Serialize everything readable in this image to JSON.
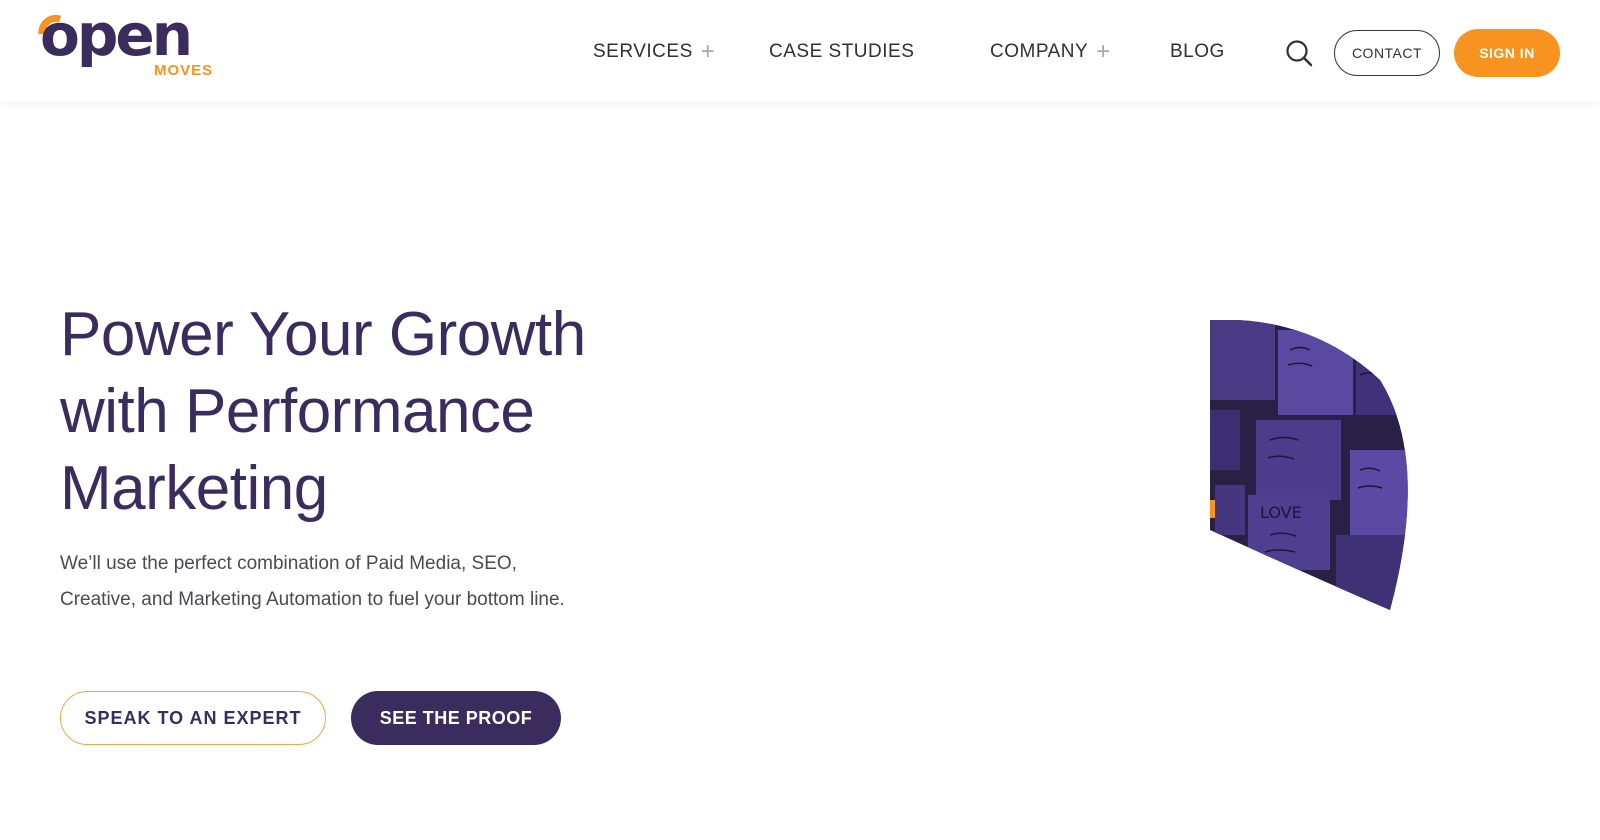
{
  "brand": {
    "logo_main": "open",
    "logo_sub": "MOVES",
    "accent_color": "#f7931e",
    "primary_color": "#3b2c5e"
  },
  "nav": {
    "items": [
      {
        "label": "SERVICES",
        "has_submenu": true,
        "submenu_icon": "plus-icon"
      },
      {
        "label": "CASE STUDIES",
        "has_submenu": false
      },
      {
        "label": "COMPANY",
        "has_submenu": true,
        "submenu_icon": "plus-icon"
      },
      {
        "label": "BLOG",
        "has_submenu": false
      }
    ],
    "plus_glyph": "+",
    "search_icon": "search-icon",
    "contact_label": "CONTACT",
    "signin_label": "SIGN IN"
  },
  "hero": {
    "title_lines": [
      "Power Your Growth",
      "with Performance",
      "Marketing"
    ],
    "subtitle_lines": [
      "We’ll use the perfect combination of Paid Media, SEO,",
      "Creative, and Marketing Automation to fuel your bottom line."
    ],
    "primary_cta": "SPEAK TO AN EXPERT",
    "secondary_cta": "SEE THE PROOF",
    "image_note_texts": [
      "LOVE"
    ]
  }
}
